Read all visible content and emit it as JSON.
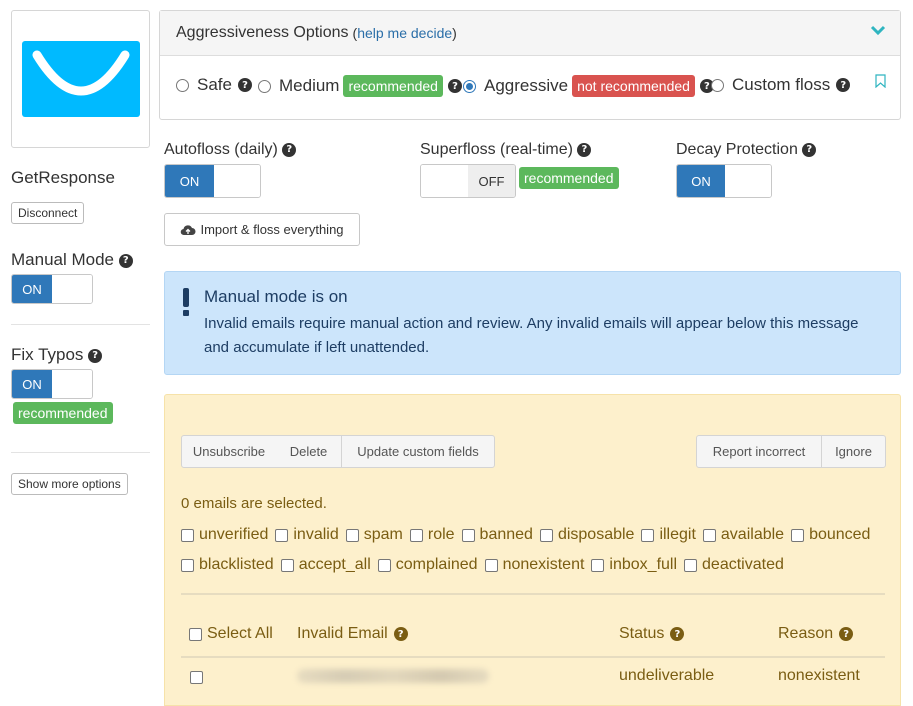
{
  "sidebar": {
    "service_name": "GetResponse",
    "disconnect_label": "Disconnect",
    "manual_mode_label": "Manual Mode",
    "manual_mode_state": "ON",
    "fix_typos_label": "Fix Typos",
    "fix_typos_state": "ON",
    "fix_typos_badge": "recommended",
    "show_more_label": "Show more options",
    "logo_icon": "getresponse-logo",
    "logo_color": "#00baff"
  },
  "aggressiveness": {
    "title": "Aggressiveness Options",
    "paren_open": "(",
    "help_link": "help me decide",
    "paren_close": ")",
    "options": [
      {
        "label": "Safe",
        "checked": false
      },
      {
        "label": "Medium",
        "badge": "recommended",
        "checked": false
      },
      {
        "label": "Aggressive",
        "badge": "not recommended",
        "checked": true
      },
      {
        "label": "Custom floss",
        "checked": false
      }
    ]
  },
  "toggles": {
    "autofloss": {
      "label": "Autofloss (daily)",
      "state": "ON"
    },
    "superfloss": {
      "label": "Superfloss (real-time)",
      "state": "OFF",
      "badge": "recommended"
    },
    "decay": {
      "label": "Decay Protection",
      "state": "ON"
    }
  },
  "import_button": "Import & floss everything",
  "alert": {
    "title": "Manual mode is on",
    "message": "Invalid emails require manual action and review. Any invalid emails will appear below this message and accumulate if left unattended."
  },
  "actions": {
    "unsubscribe": "Unsubscribe",
    "delete": "Delete",
    "update_fields": "Update custom fields",
    "report": "Report incorrect",
    "ignore": "Ignore"
  },
  "selected_text": "0 emails are selected.",
  "filters_row1": [
    "unverified",
    "invalid",
    "spam",
    "role",
    "banned",
    "disposable",
    "illegit",
    "available",
    "bounced"
  ],
  "filters_row2": [
    "blacklisted",
    "accept_all",
    "complained",
    "nonexistent",
    "inbox_full",
    "deactivated"
  ],
  "table": {
    "select_all": "Select All",
    "col_email": "Invalid Email",
    "col_status": "Status",
    "col_reason": "Reason",
    "rows": [
      {
        "status": "undeliverable",
        "reason": "nonexistent"
      }
    ]
  },
  "colors": {
    "primary": "#2f78b9",
    "success": "#5cb85c",
    "danger": "#d9534f",
    "info_bg": "#cce5fb",
    "warning_bg": "#fdf0cc"
  }
}
